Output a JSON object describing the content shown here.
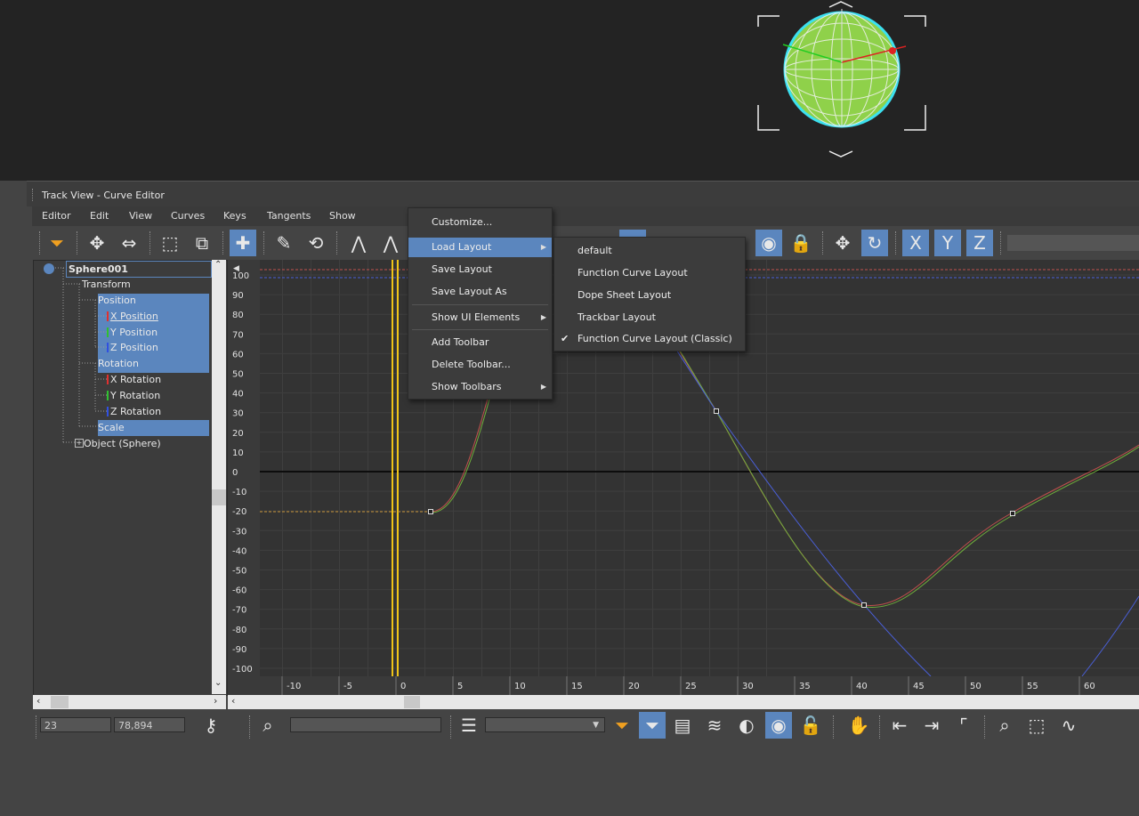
{
  "window": {
    "title": "Track View - Curve Editor"
  },
  "menubar": [
    "Editor",
    "Edit",
    "View",
    "Curves",
    "Keys",
    "Tangents",
    "Show"
  ],
  "tree": {
    "root": "Sphere001",
    "items": [
      {
        "label": "Transform",
        "selected": false
      },
      {
        "label": "Position",
        "selected": true
      },
      {
        "label": "X Position",
        "selected": true,
        "color": "#e03030"
      },
      {
        "label": "Y Position",
        "selected": true,
        "color": "#30c030"
      },
      {
        "label": "Z Position",
        "selected": true,
        "color": "#3050e0"
      },
      {
        "label": "Rotation",
        "selected": true
      },
      {
        "label": "X Rotation",
        "selected": false,
        "color": "#e03030"
      },
      {
        "label": "Y Rotation",
        "selected": false,
        "color": "#30c030"
      },
      {
        "label": "Z Rotation",
        "selected": false,
        "color": "#3050e0"
      },
      {
        "label": "Scale",
        "selected": true
      },
      {
        "label": "Object (Sphere)",
        "selected": false
      }
    ]
  },
  "graph": {
    "y_ticks": [
      "100",
      "90",
      "80",
      "70",
      "60",
      "50",
      "40",
      "30",
      "20",
      "10",
      "0",
      "-10",
      "-20",
      "-30",
      "-40",
      "-50",
      "-60",
      "-70",
      "-80",
      "-90",
      "-100"
    ],
    "x_ticks": [
      "-10",
      "-5",
      "0",
      "5",
      "10",
      "15",
      "20",
      "25",
      "30",
      "35",
      "40",
      "45",
      "50",
      "55",
      "60"
    ]
  },
  "bottom": {
    "frame": "23",
    "value": "78,894"
  },
  "context_menu": {
    "items": [
      "Customize...",
      "Load Layout",
      "Save Layout",
      "Save Layout As",
      "Show UI Elements",
      "Add Toolbar",
      "Delete Toolbar...",
      "Show Toolbars"
    ],
    "highlighted": "Load Layout"
  },
  "submenu": {
    "items": [
      "default",
      "Function Curve Layout",
      "Dope Sheet Layout",
      "Trackbar Layout",
      "Function Curve Layout (Classic)"
    ],
    "checked": "Function Curve Layout (Classic)",
    "check_glyph": "✔"
  },
  "colors": {
    "accent": "#5b86be",
    "curve_x": "#c0504d",
    "curve_y": "#6fae3c",
    "curve_z": "#4a5fd8",
    "time_slider": "#f0c419"
  }
}
